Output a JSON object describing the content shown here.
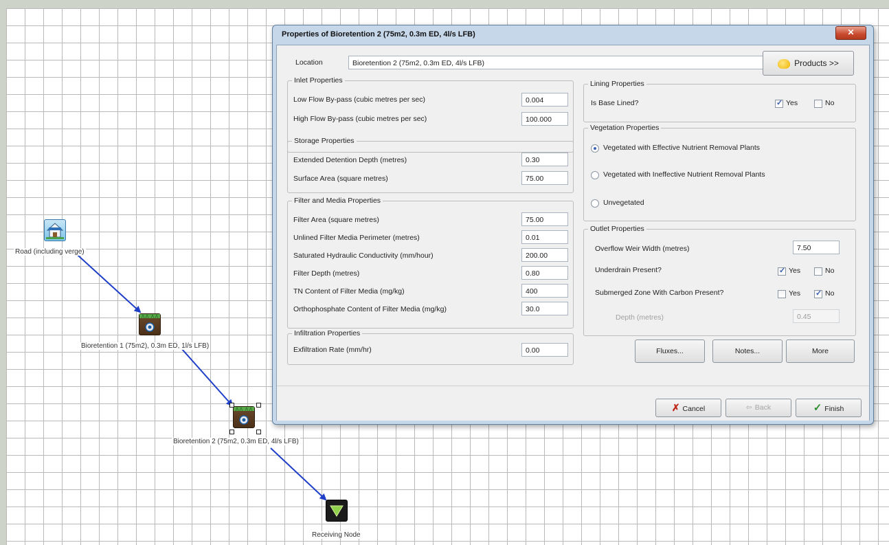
{
  "canvas": {
    "nodes": {
      "road": {
        "label": "Road (including verge)",
        "icon": "house-icon"
      },
      "bio1": {
        "label": "Bioretention 1 (75m2), 0.3m ED, 1l/s LFB)",
        "icon": "bioretention-icon"
      },
      "bio2": {
        "label": "Bioretention 2 (75m2, 0.3m ED, 4l/s LFB)",
        "icon": "bioretention-icon"
      },
      "receiving": {
        "label": "Receiving Node",
        "icon": "receiving-node-icon"
      }
    },
    "link_color": "#1f3fc8"
  },
  "dialog": {
    "title": "Properties of Bioretention 2 (75m2, 0.3m ED, 4l/s LFB)",
    "close_label": "✕",
    "location_label": "Location",
    "location_value": "Bioretention 2 (75m2, 0.3m ED, 4l/s LFB)",
    "products_label": "Products >>",
    "inlet": {
      "title": "Inlet Properties",
      "low_flow_label": "Low Flow By-pass (cubic metres per sec)",
      "low_flow_value": "0.004",
      "high_flow_label": "High Flow By-pass (cubic metres per sec)",
      "high_flow_value": "100.000"
    },
    "storage": {
      "title": "Storage Properties",
      "edd_label": "Extended Detention Depth (metres)",
      "edd_value": "0.30",
      "area_label": "Surface Area (square metres)",
      "area_value": "75.00"
    },
    "filter": {
      "title": "Filter and Media Properties",
      "area_label": "Filter Area (square metres)",
      "area_value": "75.00",
      "perimeter_label": "Unlined Filter Media Perimeter (metres)",
      "perimeter_value": "0.01",
      "conductivity_label": "Saturated Hydraulic Conductivity (mm/hour)",
      "conductivity_value": "200.00",
      "depth_label": "Filter Depth (metres)",
      "depth_value": "0.80",
      "tn_label": "TN Content of Filter Media (mg/kg)",
      "tn_value": "400",
      "ortho_label": "Orthophosphate Content of Filter Media (mg/kg)",
      "ortho_value": "30.0"
    },
    "infiltration": {
      "title": "Infiltration Properties",
      "rate_label": "Exfiltration Rate (mm/hr)",
      "rate_value": "0.00"
    },
    "lining": {
      "title": "Lining Properties",
      "question": "Is Base Lined?",
      "yes_label": "Yes",
      "no_label": "No",
      "yes_checked": true,
      "no_checked": false
    },
    "vegetation": {
      "title": "Vegetation Properties",
      "option_effective": "Vegetated with Effective Nutrient Removal Plants",
      "option_ineffective": "Vegetated with Ineffective Nutrient Removal Plants",
      "option_unvegetated": "Unvegetated",
      "selected": "effective"
    },
    "outlet": {
      "title": "Outlet Properties",
      "weir_label": "Overflow Weir Width (metres)",
      "weir_value": "7.50",
      "underdrain_label": "Underdrain Present?",
      "underdrain_yes_label": "Yes",
      "underdrain_no_label": "No",
      "underdrain_yes_checked": true,
      "underdrain_no_checked": false,
      "submerged_label": "Submerged Zone With Carbon Present?",
      "submerged_yes_label": "Yes",
      "submerged_no_label": "No",
      "submerged_yes_checked": false,
      "submerged_no_checked": true,
      "depth_label": "Depth (metres)",
      "depth_value": "0.45"
    },
    "buttons": {
      "fluxes": "Fluxes...",
      "notes": "Notes...",
      "more": "More",
      "cancel": "Cancel",
      "back": "Back",
      "finish": "Finish"
    }
  }
}
